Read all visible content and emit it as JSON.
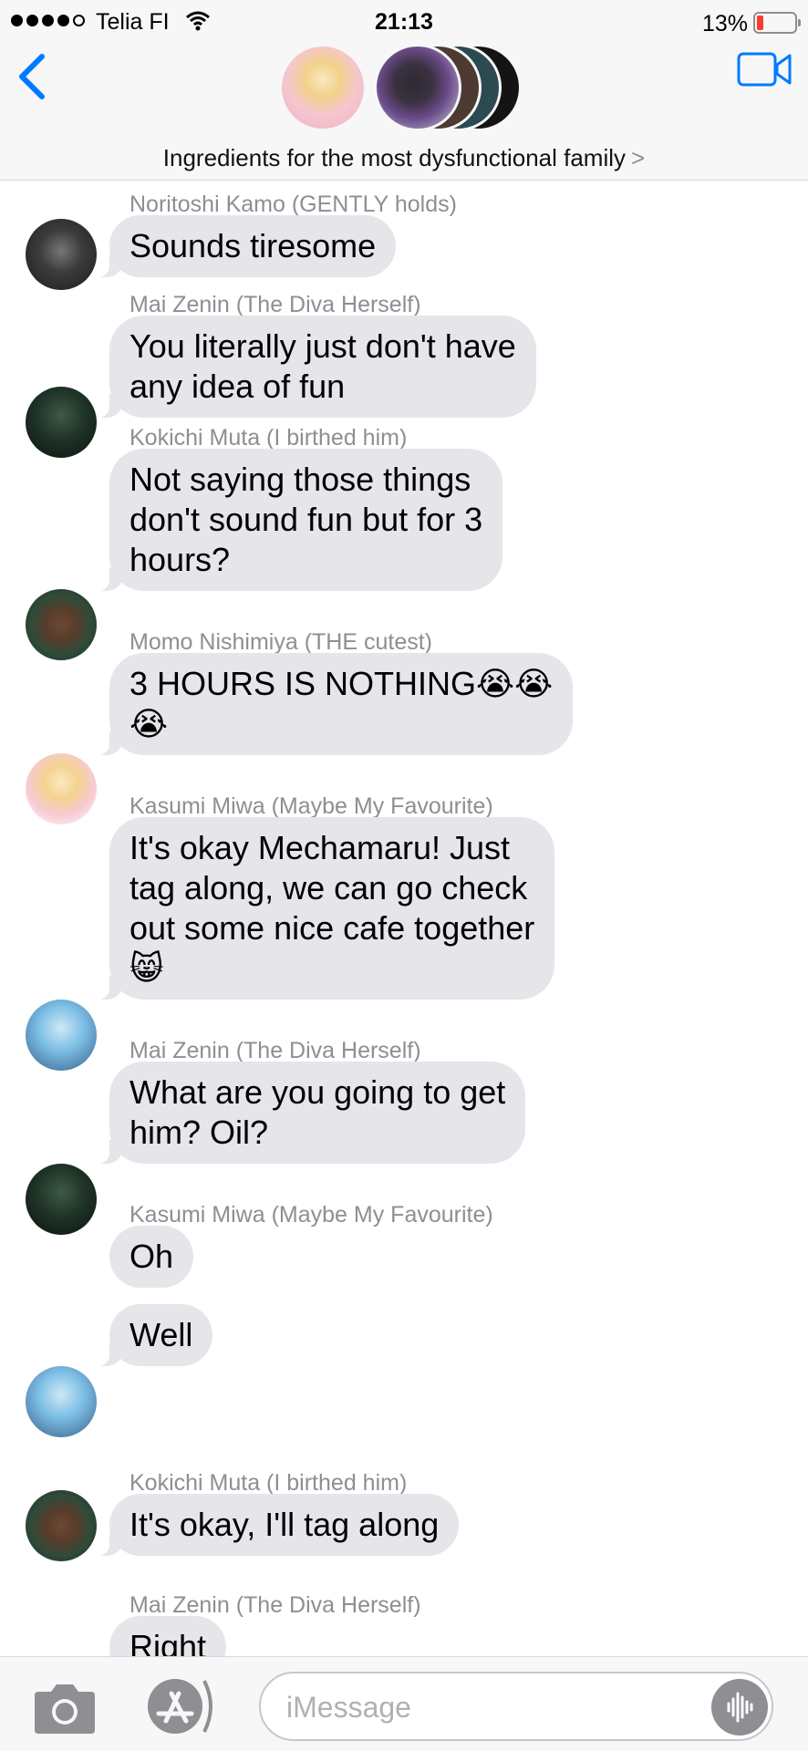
{
  "status_bar": {
    "carrier": "Telia FI",
    "time": "21:13",
    "battery": "13%"
  },
  "group": {
    "title": "Ingredients for the most dysfunctional family",
    "chevron": ">"
  },
  "messages": [
    {
      "sender": "Noritoshi Kamo (GENTLY holds)",
      "bubbles": [
        "Sounds tiresome"
      ]
    },
    {
      "sender": "Mai Zenin (The Diva Herself)",
      "bubbles": [
        "You literally just don't have\nany idea of fun"
      ]
    },
    {
      "sender": "Kokichi Muta (I birthed him)",
      "bubbles": [
        "Not saying those things\ndon't sound fun but for 3\nhours?"
      ]
    },
    {
      "sender": "Momo Nishimiya (THE cutest)",
      "bubbles": [
        "3 HOURS IS NOTHING😭😭\n😭"
      ]
    },
    {
      "sender": "Kasumi Miwa (Maybe My Favourite)",
      "bubbles": [
        "It's okay Mechamaru! Just\ntag along, we can go check\nout some nice cafe together\n😸"
      ]
    },
    {
      "sender": "Mai Zenin (The Diva Herself)",
      "bubbles": [
        "What are you going to get\nhim? Oil?"
      ]
    },
    {
      "sender": "Kasumi Miwa (Maybe My Favourite)",
      "bubbles": [
        "Oh",
        "Well"
      ]
    },
    {
      "sender": "Kokichi Muta (I birthed him)",
      "bubbles": [
        "It's okay, I'll tag along"
      ]
    },
    {
      "sender": "Mai Zenin (The Diva Herself)",
      "bubbles": [
        "Right"
      ]
    }
  ],
  "input": {
    "placeholder": "iMessage"
  },
  "icons": {
    "back": "chevron-left-icon",
    "video": "video-camera-icon",
    "camera": "camera-icon",
    "apps": "app-store-icon",
    "audio": "audio-waveform-icon"
  },
  "colors": {
    "accent": "#007aff",
    "bubble_received": "#e5e5ea",
    "sender_label": "#8e8e93",
    "battery_low": "#ff3b30"
  }
}
